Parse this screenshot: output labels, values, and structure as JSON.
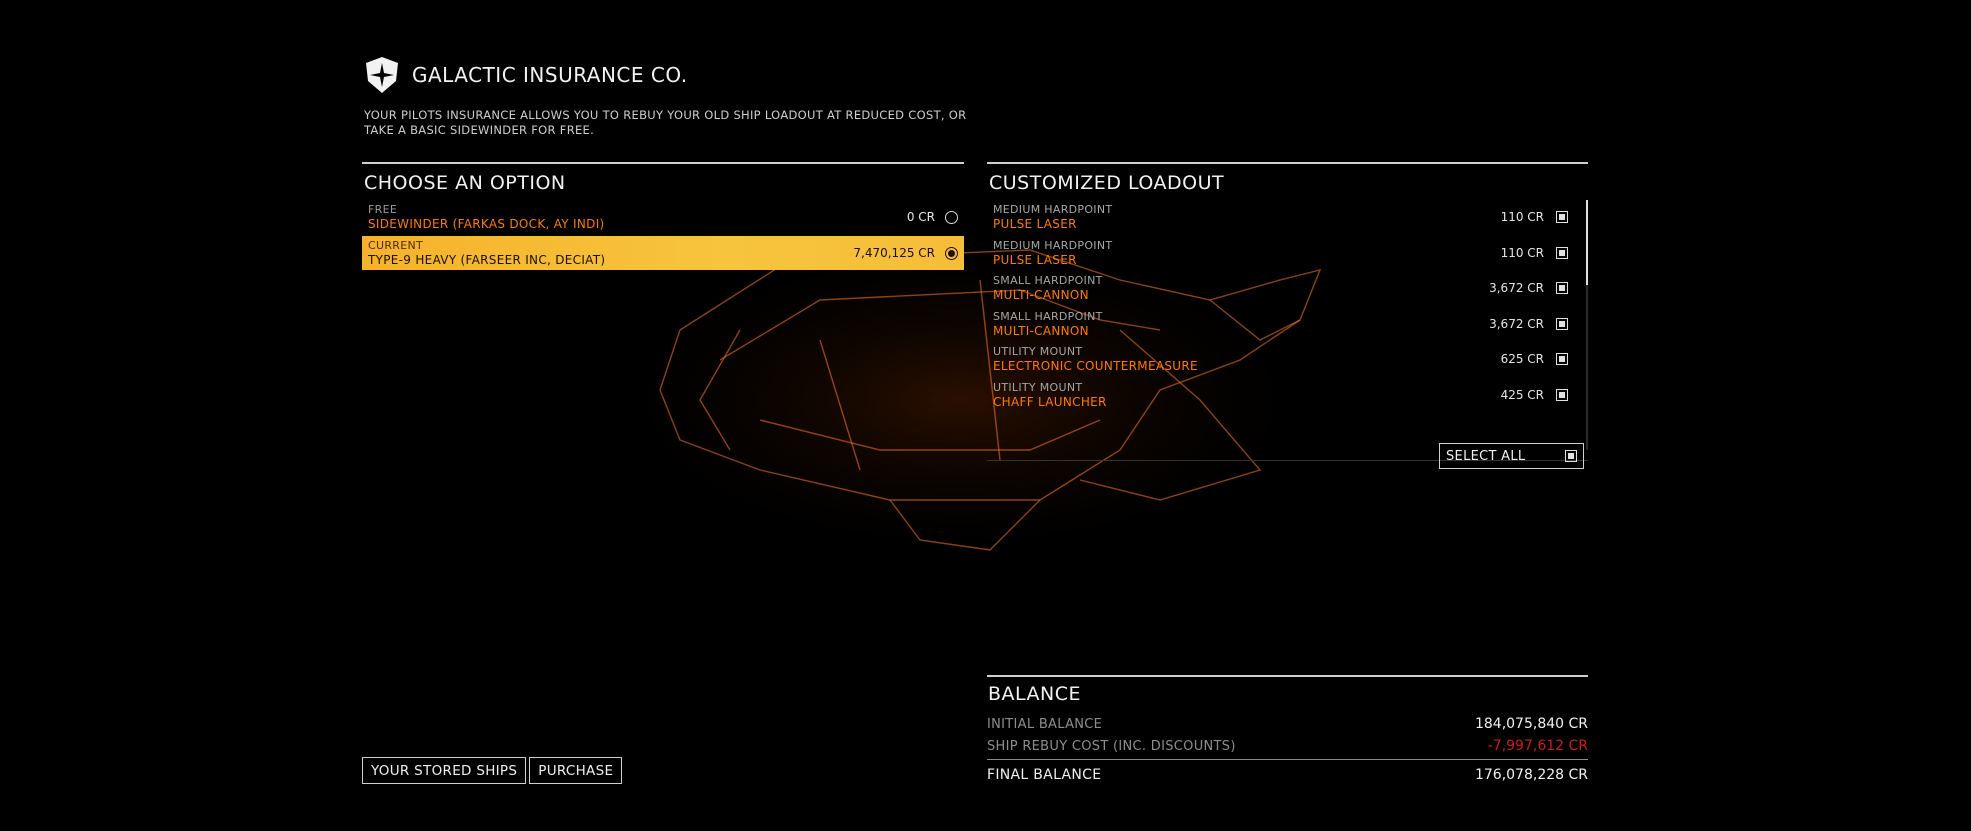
{
  "header": {
    "title": "GALACTIC INSURANCE CO.",
    "description": "YOUR PILOTS INSURANCE ALLOWS YOU TO REBUY YOUR OLD SHIP LOADOUT AT REDUCED COST, OR TAKE A BASIC SIDEWINDER FOR FREE."
  },
  "options": {
    "title": "CHOOSE AN OPTION",
    "items": [
      {
        "kind": "FREE",
        "name": "SIDEWINDER (FARKAS DOCK, AY INDI)",
        "price": "0 CR",
        "selected": false
      },
      {
        "kind": "CURRENT",
        "name": "TYPE-9 HEAVY (FARSEER INC, DECIAT)",
        "price": "7,470,125 CR",
        "selected": true
      }
    ]
  },
  "loadout": {
    "title": "CUSTOMIZED LOADOUT",
    "items": [
      {
        "slot": "MEDIUM HARDPOINT",
        "module": "PULSE LASER",
        "price": "110 CR",
        "checked": true
      },
      {
        "slot": "MEDIUM HARDPOINT",
        "module": "PULSE LASER",
        "price": "110 CR",
        "checked": true
      },
      {
        "slot": "SMALL HARDPOINT",
        "module": "MULTI-CANNON",
        "price": "3,672 CR",
        "checked": true
      },
      {
        "slot": "SMALL HARDPOINT",
        "module": "MULTI-CANNON",
        "price": "3,672 CR",
        "checked": true
      },
      {
        "slot": "UTILITY MOUNT",
        "module": "ELECTRONIC COUNTERMEASURE",
        "price": "625 CR",
        "checked": true
      },
      {
        "slot": "UTILITY MOUNT",
        "module": "CHAFF LAUNCHER",
        "price": "425 CR",
        "checked": true
      }
    ],
    "select_all_label": "SELECT ALL"
  },
  "balance": {
    "title": "BALANCE",
    "initial_label": "INITIAL BALANCE",
    "initial_value": "184,075,840 CR",
    "rebuy_label": "SHIP REBUY COST (INC. DISCOUNTS)",
    "rebuy_value": "-7,997,612 CR",
    "final_label": "FINAL BALANCE",
    "final_value": "176,078,228 CR"
  },
  "buttons": {
    "stored_ships": "YOUR STORED SHIPS",
    "purchase": "PURCHASE"
  },
  "colors": {
    "accent_orange": "#ff7a00",
    "selected_yellow": "#f7c43e",
    "negative_red": "#c81d1d"
  }
}
